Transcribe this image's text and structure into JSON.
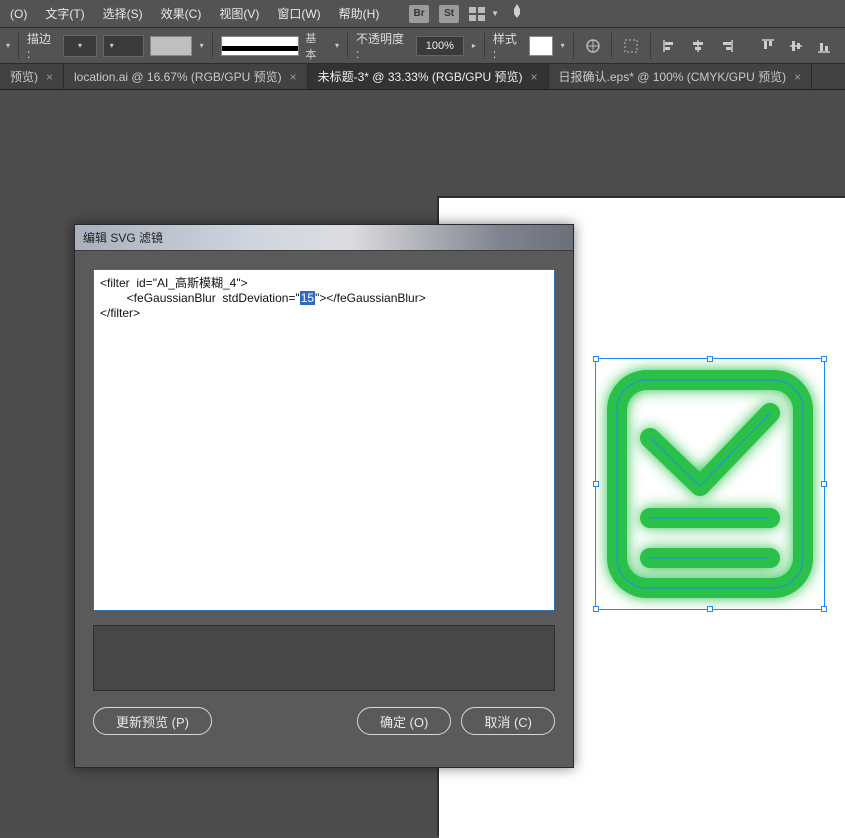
{
  "menu": {
    "items": [
      "(O)",
      "文字(T)",
      "选择(S)",
      "效果(C)",
      "视图(V)",
      "窗口(W)",
      "帮助(H)"
    ],
    "right_badges": [
      "Br",
      "St"
    ]
  },
  "controlbar": {
    "stroke_label": "描边 :",
    "profile_label": "基本",
    "opacity_label": "不透明度 :",
    "opacity_value": "100%",
    "style_label": "样式 :"
  },
  "tabs": [
    {
      "label": "预览)",
      "active": false,
      "closeable": true
    },
    {
      "label": "location.ai @ 16.67% (RGB/GPU 预览)",
      "active": false,
      "closeable": true
    },
    {
      "label": "未标题-3* @ 33.33% (RGB/GPU 预览)",
      "active": true,
      "closeable": true
    },
    {
      "label": "日报确认.eps* @ 100% (CMYK/GPU 预览)",
      "active": false,
      "closeable": true
    }
  ],
  "dialog": {
    "title": "编辑 SVG 滤镜",
    "code_prefix": "<filter  id=\"AI_高斯模糊_4\">\n        <feGaussianBlur  stdDeviation=\"",
    "code_selected": "15",
    "code_suffix": "\"></feGaussianBlur>\n</filter>",
    "buttons": {
      "update_preview": "更新预览 (P)",
      "ok": "确定 (O)",
      "cancel": "取消 (C)"
    }
  }
}
